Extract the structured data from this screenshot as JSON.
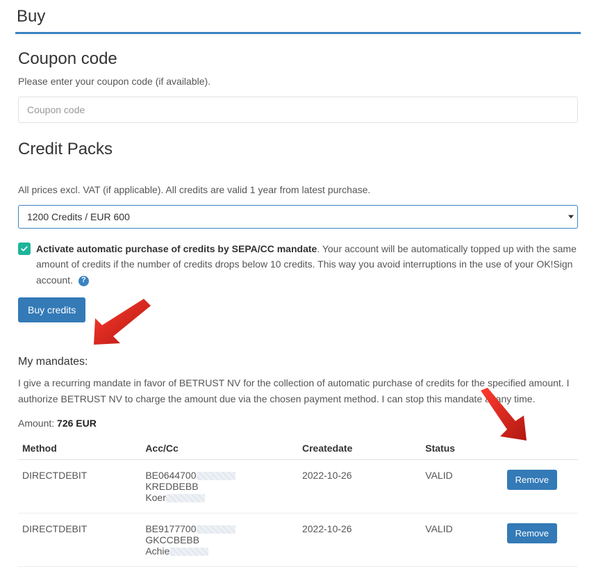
{
  "page": {
    "title": "Buy"
  },
  "coupon": {
    "heading": "Coupon code",
    "hint": "Please enter your coupon code (if available).",
    "placeholder": "Coupon code"
  },
  "packs": {
    "heading": "Credit Packs",
    "note": "All prices excl. VAT (if applicable). All credits are valid 1 year from latest purchase.",
    "selected": "1200 Credits /  EUR 600"
  },
  "auto": {
    "bold": "Activate automatic purchase of credits by SEPA/CC mandate",
    "rest": ". Your account will be automatically topped up with the same amount of credits if the number of credits drops below 10 credits. This way you avoid interruptions in the use of your OK!Sign account."
  },
  "buy_button": "Buy credits",
  "mandates": {
    "title": "My mandates:",
    "text": "I give a recurring mandate in favor of BETRUST NV for the collection of automatic purchase of credits for the specified amount. I authorize BETRUST NV to charge the amount due via the chosen payment method. I can stop this mandate at any time.",
    "amount_label": "Amount: ",
    "amount_value": "726 EUR",
    "headers": {
      "method": "Method",
      "acc": "Acc/Cc",
      "date": "Createdate",
      "status": "Status"
    },
    "rows": [
      {
        "method": "DIRECTDEBIT",
        "acc1": "BE0644700",
        "acc2": "KREDBEBB",
        "acc3": "Koer",
        "date": "2022-10-26",
        "status": "VALID",
        "remove": "Remove"
      },
      {
        "method": "DIRECTDEBIT",
        "acc1": "BE9177700",
        "acc2": "GKCCBEBB",
        "acc3": "Achie",
        "date": "2022-10-26",
        "status": "VALID",
        "remove": "Remove"
      }
    ]
  }
}
